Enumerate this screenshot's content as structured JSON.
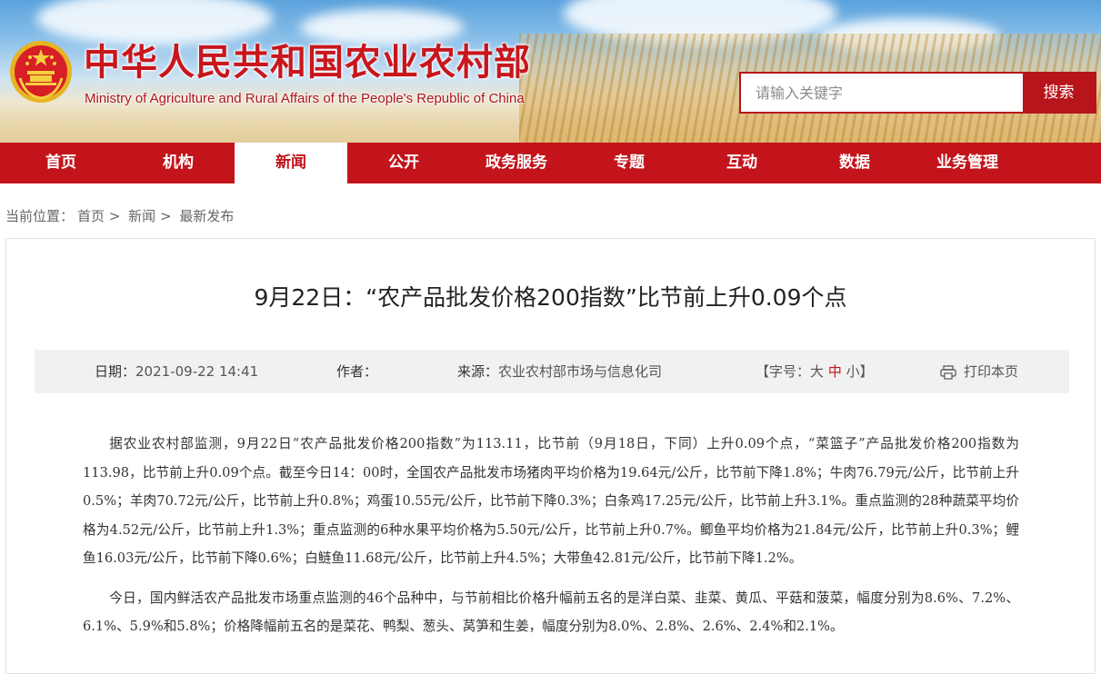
{
  "header": {
    "site_title": "中华人民共和国农业农村部",
    "site_subtitle": "Ministry of Agriculture and Rural Affairs of the People's Republic of China",
    "search": {
      "placeholder": "请输入关键字",
      "button_label": "搜索"
    }
  },
  "nav": {
    "items": [
      {
        "label": "首页"
      },
      {
        "label": "机构"
      },
      {
        "label": "新闻",
        "active": true
      },
      {
        "label": "公开"
      },
      {
        "label": "政务服务"
      },
      {
        "label": "专题"
      },
      {
        "label": "互动"
      },
      {
        "label": "数据"
      },
      {
        "label": "业务管理"
      }
    ]
  },
  "breadcrumb": {
    "prefix": "当前位置：",
    "items": [
      "首页",
      "新闻",
      "最新发布"
    ],
    "separator": ">"
  },
  "article": {
    "title": "9月22日：“农产品批发价格200指数”比节前上升0.09个点",
    "meta": {
      "date_label": "日期：",
      "date_value": "2021-09-22 14:41",
      "author_label": "作者：",
      "author_value": "",
      "source_label": "来源：",
      "source_value": "农业农村部市场与信息化司",
      "font_size_label": "【字号：",
      "font_size_options": [
        "大",
        "中",
        "小"
      ],
      "font_size_current": "中",
      "font_size_close": "】",
      "print_label": "打印本页"
    },
    "paragraphs": [
      "据农业农村部监测，9月22日“农产品批发价格200指数”为113.11，比节前（9月18日，下同）上升0.09个点，“菜篮子”产品批发价格200指数为113.98，比节前上升0.09个点。截至今日14：00时，全国农产品批发市场猪肉平均价格为19.64元/公斤，比节前下降1.8%；牛肉76.79元/公斤，比节前上升0.5%；羊肉70.72元/公斤，比节前上升0.8%；鸡蛋10.55元/公斤，比节前下降0.3%；白条鸡17.25元/公斤，比节前上升3.1%。重点监测的28种蔬菜平均价格为4.52元/公斤，比节前上升1.3%；重点监测的6种水果平均价格为5.50元/公斤，比节前上升0.7%。鲫鱼平均价格为21.84元/公斤，比节前上升0.3%；鲤鱼16.03元/公斤，比节前下降0.6%；白鲢鱼11.68元/公斤，比节前上升4.5%；大带鱼42.81元/公斤，比节前下降1.2%。",
      "今日，国内鲜活农产品批发市场重点监测的46个品种中，与节前相比价格升幅前五名的是洋白菜、韭菜、黄瓜、平菇和菠菜，幅度分别为8.6%、7.2%、6.1%、5.9%和5.8%；价格降幅前五名的是菜花、鸭梨、葱头、莴笋和生姜，幅度分别为8.0%、2.8%、2.6%、2.4%和2.1%。"
    ]
  },
  "colors": {
    "brand_red": "#c3141b",
    "nav_active_bg": "#ffffff",
    "meta_bg": "#f1f1f1"
  },
  "icons": {
    "emblem": "national-emblem-icon",
    "print": "printer-icon"
  }
}
